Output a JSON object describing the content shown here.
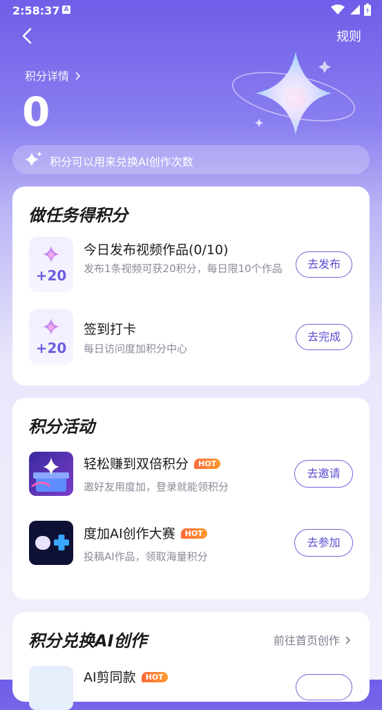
{
  "status": {
    "time": "2:58:37",
    "a_badge": "A"
  },
  "header": {
    "rules_label": "规则",
    "points_detail_label": "积分详情",
    "points_value": "0"
  },
  "notice": {
    "text": "积分可以用来兑换AI创作次数"
  },
  "tasks": {
    "title": "做任务得积分",
    "items": [
      {
        "plus": "+20",
        "title": "今日发布视频作品(0/10)",
        "desc": "发布1条视频可获20积分，每日限10个作品",
        "button": "去发布"
      },
      {
        "plus": "+20",
        "title": "签到打卡",
        "desc": "每日访问度加积分中心",
        "button": "去完成"
      }
    ]
  },
  "activities": {
    "title": "积分活动",
    "items": [
      {
        "title": "轻松赚到双倍积分",
        "badge": "HOT",
        "desc": "邀好友用度加，登录就能领积分",
        "button": "去邀请"
      },
      {
        "title": "度加AI创作大赛",
        "badge": "HOT",
        "desc": "投稿AI作品，领取海量积分",
        "button": "去参加"
      }
    ]
  },
  "exchange": {
    "title": "积分兑换AI创作",
    "link": "前往首页创作",
    "first_item_title": "AI剪同款",
    "first_item_badge": "HOT"
  },
  "colors": {
    "accent": "#6e63d9",
    "hot": "#ff7a35",
    "bg_top": "#6f5ee8"
  }
}
